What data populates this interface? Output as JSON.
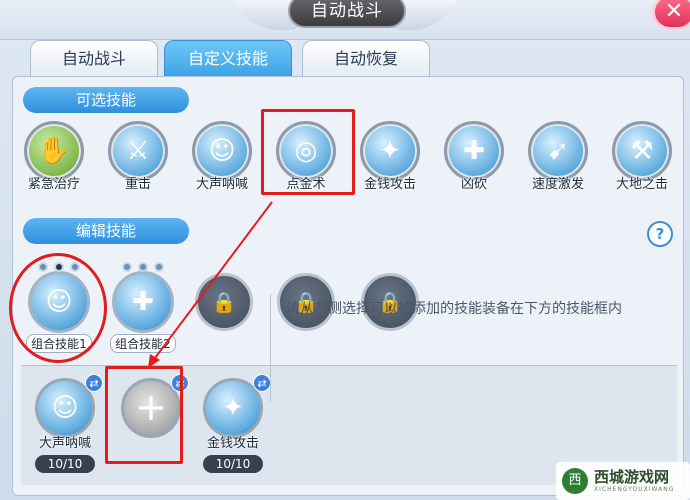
{
  "window": {
    "title": "自动战斗",
    "close_icon": "close-icon"
  },
  "tabs": [
    {
      "label": "自动战斗",
      "active": false
    },
    {
      "label": "自定义技能",
      "active": true
    },
    {
      "label": "自动恢复",
      "active": false
    }
  ],
  "available": {
    "section_label": "可选技能",
    "skills": [
      {
        "label": "紧急治疗",
        "icon": "hand-icon",
        "glyph": "✋"
      },
      {
        "label": "重击",
        "icon": "sword-icon",
        "glyph": "⚔"
      },
      {
        "label": "大声呐喊",
        "icon": "shout-icon",
        "glyph": "☺"
      },
      {
        "label": "点金术",
        "icon": "coins-icon",
        "glyph": "◎"
      },
      {
        "label": "金钱攻击",
        "icon": "money-strike-icon",
        "glyph": "✦"
      },
      {
        "label": "凶砍",
        "icon": "sword-plus-icon",
        "glyph": "✚"
      },
      {
        "label": "速度激发",
        "icon": "runner-icon",
        "glyph": "➹"
      },
      {
        "label": "大地之击",
        "icon": "ground-slam-icon",
        "glyph": "⚒"
      }
    ]
  },
  "edit": {
    "section_label": "编辑技能",
    "help_glyph": "?",
    "combos": [
      {
        "name": "组合技能1",
        "glyph": "☺"
      },
      {
        "name": "组合技能2",
        "glyph": "✚"
      }
    ],
    "lock_glyph": "🔒",
    "locked_slots": 3
  },
  "bottom": {
    "slots": [
      {
        "label": "大声呐喊",
        "count": "10/10",
        "glyph": "☺"
      },
      {
        "label": "",
        "count": "",
        "glyph": "+"
      },
      {
        "label": "金钱攻击",
        "count": "10/10",
        "glyph": "✦"
      }
    ],
    "hint": "请从左侧选择可以被添加的技能装备在下方的技能框内"
  },
  "watermark": {
    "title": "西城游戏网",
    "subtitle": "XICHENGYOUXIWANG"
  },
  "colors": {
    "highlight": "#e21c1c",
    "accent": "#3ea3e6"
  }
}
